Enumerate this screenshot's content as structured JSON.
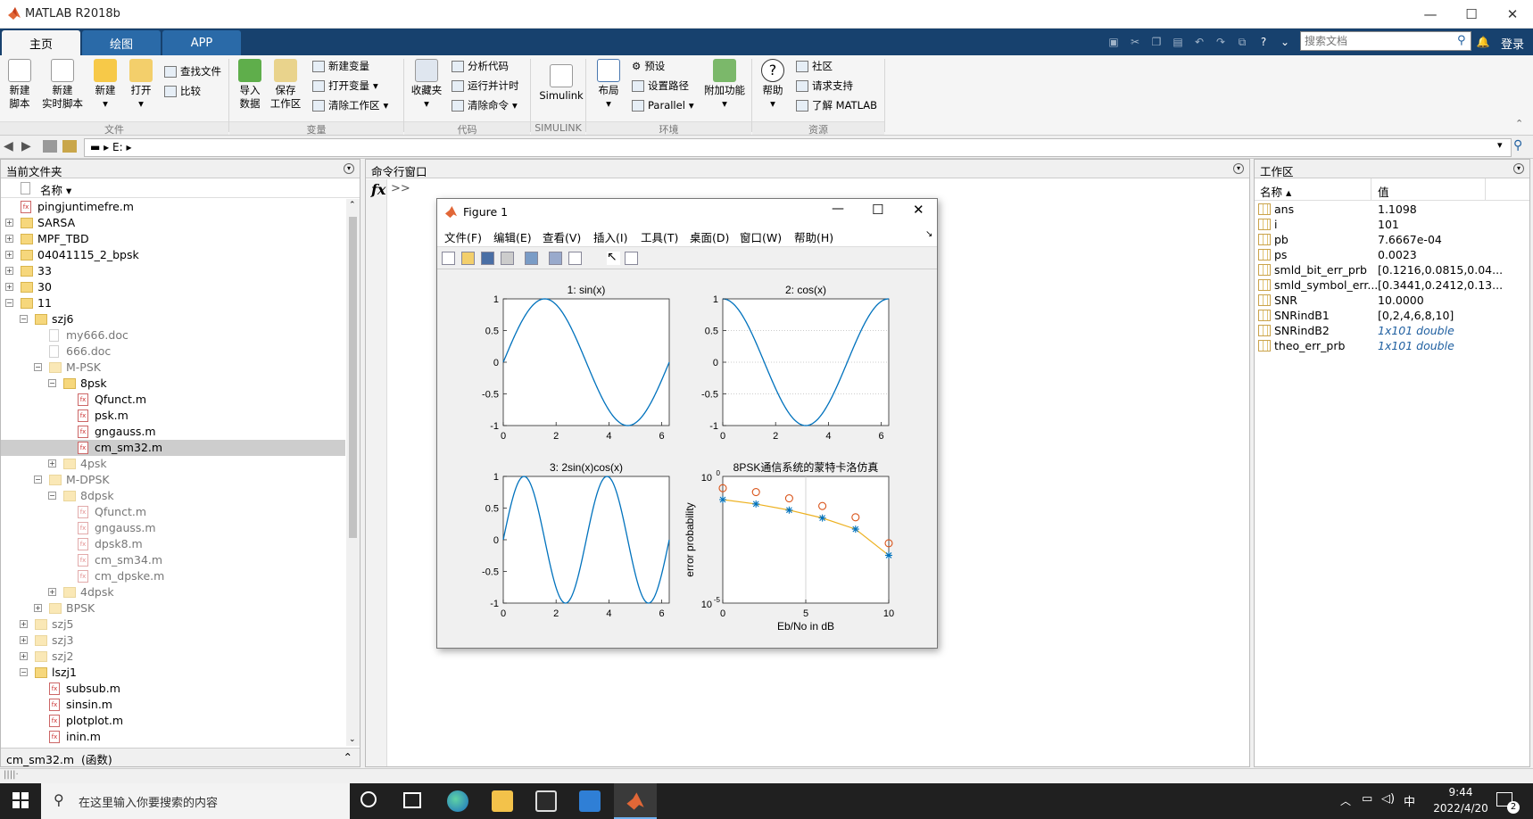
{
  "app": {
    "title": "MATLAB R2018b"
  },
  "window_controls": {
    "minimize": "—",
    "maximize": "☐",
    "close": "✕"
  },
  "ribbon_tabs": [
    {
      "label": "主页",
      "active": true
    },
    {
      "label": "绘图",
      "active": false
    },
    {
      "label": "APP",
      "active": false
    }
  ],
  "search": {
    "placeholder": "搜索文档"
  },
  "login_label": "登录",
  "ribbon": {
    "file_group": {
      "new_script": "新建\n脚本",
      "new_live_script": "新建\n实时脚本",
      "new": "新建",
      "open": "打开",
      "find_files": "查找文件",
      "compare": "比较",
      "group_label": "文件"
    },
    "variable_group": {
      "import_data": "导入\n数据",
      "save_workspace": "保存\n工作区",
      "new_variable": "新建变量",
      "open_variable": "打开变量",
      "clear_workspace": "清除工作区",
      "group_label": "变量"
    },
    "code_group": {
      "favorites": "收藏夹",
      "analyze_code": "分析代码",
      "run_and_time": "运行并计时",
      "clear_commands": "清除命令",
      "group_label": "代码"
    },
    "simulink_group": {
      "simulink": "Simulink",
      "group_label": "SIMULINK"
    },
    "env_group": {
      "layout": "布局",
      "preferences": "预设",
      "set_path": "设置路径",
      "parallel": "Parallel",
      "add_ons": "附加功能",
      "group_label": "环境"
    },
    "resources_group": {
      "help": "帮助",
      "community": "社区",
      "request_support": "请求支持",
      "learn_matlab": "了解 MATLAB",
      "group_label": "资源"
    }
  },
  "address": {
    "path": "E:"
  },
  "current_folder": {
    "title": "当前文件夹",
    "column_name": "名称",
    "items": [
      {
        "name": "pingjuntimefre.m",
        "type": "m",
        "level": 0,
        "exp": ""
      },
      {
        "name": "SARSA",
        "type": "folder",
        "level": 0,
        "exp": "+"
      },
      {
        "name": "MPF_TBD",
        "type": "folder",
        "level": 0,
        "exp": "+"
      },
      {
        "name": "04041115_2_bpsk",
        "type": "folder",
        "level": 0,
        "exp": "+"
      },
      {
        "name": "33",
        "type": "folder",
        "level": 0,
        "exp": "+"
      },
      {
        "name": "30",
        "type": "folder",
        "level": 0,
        "exp": "+"
      },
      {
        "name": "11",
        "type": "folder",
        "level": 0,
        "exp": "−"
      },
      {
        "name": "szj6",
        "type": "folder",
        "level": 1,
        "exp": "−"
      },
      {
        "name": "my666.doc",
        "type": "doc",
        "level": 2,
        "exp": "",
        "dim": true
      },
      {
        "name": "666.doc",
        "type": "doc",
        "level": 2,
        "exp": "",
        "dim": true
      },
      {
        "name": "M-PSK",
        "type": "folder",
        "level": 2,
        "exp": "−",
        "dim": true
      },
      {
        "name": "8psk",
        "type": "folder",
        "level": 3,
        "exp": "−"
      },
      {
        "name": "Qfunct.m",
        "type": "m",
        "level": 4,
        "exp": ""
      },
      {
        "name": "psk.m",
        "type": "m",
        "level": 4,
        "exp": ""
      },
      {
        "name": "gngauss.m",
        "type": "m",
        "level": 4,
        "exp": ""
      },
      {
        "name": "cm_sm32.m",
        "type": "m",
        "level": 4,
        "exp": "",
        "selected": true
      },
      {
        "name": "4psk",
        "type": "folder",
        "level": 3,
        "exp": "+",
        "dim": true
      },
      {
        "name": "M-DPSK",
        "type": "folder",
        "level": 2,
        "exp": "−",
        "dim": true
      },
      {
        "name": "8dpsk",
        "type": "folder",
        "level": 3,
        "exp": "−",
        "dim": true
      },
      {
        "name": "Qfunct.m",
        "type": "m",
        "level": 4,
        "exp": "",
        "dim": true
      },
      {
        "name": "gngauss.m",
        "type": "m",
        "level": 4,
        "exp": "",
        "dim": true
      },
      {
        "name": "dpsk8.m",
        "type": "m",
        "level": 4,
        "exp": "",
        "dim": true
      },
      {
        "name": "cm_sm34.m",
        "type": "m",
        "level": 4,
        "exp": "",
        "dim": true
      },
      {
        "name": "cm_dpske.m",
        "type": "m",
        "level": 4,
        "exp": "",
        "dim": true
      },
      {
        "name": "4dpsk",
        "type": "folder",
        "level": 3,
        "exp": "+",
        "dim": true
      },
      {
        "name": "BPSK",
        "type": "folder",
        "level": 2,
        "exp": "+",
        "dim": true
      },
      {
        "name": "szj5",
        "type": "folder",
        "level": 1,
        "exp": "+",
        "dim": true
      },
      {
        "name": "szj3",
        "type": "folder",
        "level": 1,
        "exp": "+",
        "dim": true
      },
      {
        "name": "szj2",
        "type": "folder",
        "level": 1,
        "exp": "+",
        "dim": true
      },
      {
        "name": "lszj1",
        "type": "folder",
        "level": 1,
        "exp": "−"
      },
      {
        "name": "subsub.m",
        "type": "m",
        "level": 2,
        "exp": ""
      },
      {
        "name": "sinsin.m",
        "type": "m",
        "level": 2,
        "exp": ""
      },
      {
        "name": "plotplot.m",
        "type": "m",
        "level": 2,
        "exp": ""
      },
      {
        "name": "inin.m",
        "type": "m",
        "level": 2,
        "exp": ""
      }
    ],
    "details": "cm_sm32.m  (函数)"
  },
  "command_window": {
    "title": "命令行窗口",
    "prompt": ">>",
    "fx": "fx"
  },
  "workspace": {
    "title": "工作区",
    "col_name": "名称",
    "col_value": "值",
    "rows": [
      {
        "name": "ans",
        "value": "1.1098",
        "italic": false
      },
      {
        "name": "i",
        "value": "101",
        "italic": false
      },
      {
        "name": "pb",
        "value": "7.6667e-04",
        "italic": false
      },
      {
        "name": "ps",
        "value": "0.0023",
        "italic": false
      },
      {
        "name": "smld_bit_err_prb",
        "value": "[0.1216,0.0815,0.04...",
        "italic": false
      },
      {
        "name": "smld_symbol_err...",
        "value": "[0.3441,0.2412,0.13...",
        "italic": false
      },
      {
        "name": "SNR",
        "value": "10.0000",
        "italic": false
      },
      {
        "name": "SNRindB1",
        "value": "[0,2,4,6,8,10]",
        "italic": false
      },
      {
        "name": "SNRindB2",
        "value": "1x101 double",
        "italic": true
      },
      {
        "name": "theo_err_prb",
        "value": "1x101 double",
        "italic": true
      }
    ]
  },
  "figure": {
    "title": "Figure 1",
    "menus": [
      "文件(F)",
      "编辑(E)",
      "查看(V)",
      "插入(I)",
      "工具(T)",
      "桌面(D)",
      "窗口(W)",
      "帮助(H)"
    ]
  },
  "chart_data": [
    {
      "type": "line",
      "title": "1:  sin(x)",
      "function": "sin",
      "x_range": [
        0,
        6.2832
      ],
      "xticks": [
        "0",
        "2",
        "4",
        "6"
      ],
      "yticks": [
        "1",
        "0.5",
        "0",
        "-0.5",
        "-1"
      ],
      "ylim": [
        -1,
        1
      ],
      "xlim": [
        0,
        6.2832
      ],
      "color": "#0072bd"
    },
    {
      "type": "line",
      "title": "2:  cos(x)",
      "function": "cos",
      "x_range": [
        0,
        6.2832
      ],
      "xticks": [
        "0",
        "2",
        "4",
        "6"
      ],
      "yticks": [
        "1",
        "0.5",
        "0",
        "-0.5",
        "-1"
      ],
      "ylim": [
        -1,
        1
      ],
      "xlim": [
        0,
        6.2832
      ],
      "grid": "y-dotted",
      "color": "#0072bd"
    },
    {
      "type": "line",
      "title": "3:  2sin(x)cos(x)",
      "function": "sin2x",
      "x_range": [
        0,
        6.2832
      ],
      "xticks": [
        "0",
        "2",
        "4",
        "6"
      ],
      "yticks": [
        "1",
        "0.5",
        "0",
        "-0.5",
        "-1"
      ],
      "ylim": [
        -1,
        1
      ],
      "xlim": [
        0,
        6.2832
      ],
      "color": "#0072bd"
    },
    {
      "type": "scatter",
      "title": "8PSK通信系统的蒙特卡洛仿真",
      "xlabel": "Eb/No in dB",
      "ylabel": "error probability",
      "xticks": [
        "0",
        "5",
        "10"
      ],
      "ytick_top": "10^0",
      "ytick_bottom": "10^-5",
      "xlim": [
        0,
        10
      ],
      "ylim_log10": [
        -5,
        0
      ],
      "grid": "x at 5",
      "series": [
        {
          "marker": "o",
          "color": "#d95319",
          "x": [
            0,
            2,
            4,
            6,
            8,
            10
          ],
          "y": [
            0.3441,
            0.2412,
            0.1365,
            0.0679,
            0.0244,
            0.0023
          ]
        },
        {
          "marker": "*",
          "color": "#0072bd",
          "x": [
            0,
            2,
            4,
            6,
            8,
            10
          ],
          "y": [
            0.1216,
            0.0815,
            0.0468,
            0.0228,
            0.0083,
            0.00077
          ]
        },
        {
          "marker": "line",
          "color": "#edb120",
          "x": [
            0,
            2,
            4,
            6,
            8,
            10
          ],
          "y": [
            0.1216,
            0.0815,
            0.0468,
            0.0228,
            0.0083,
            0.00077
          ]
        }
      ]
    }
  ],
  "taskbar": {
    "search_placeholder": "在这里输入你要搜索的内容",
    "time": "9:44",
    "date": "2022/4/20",
    "ime": "中",
    "notif_count": "2"
  }
}
